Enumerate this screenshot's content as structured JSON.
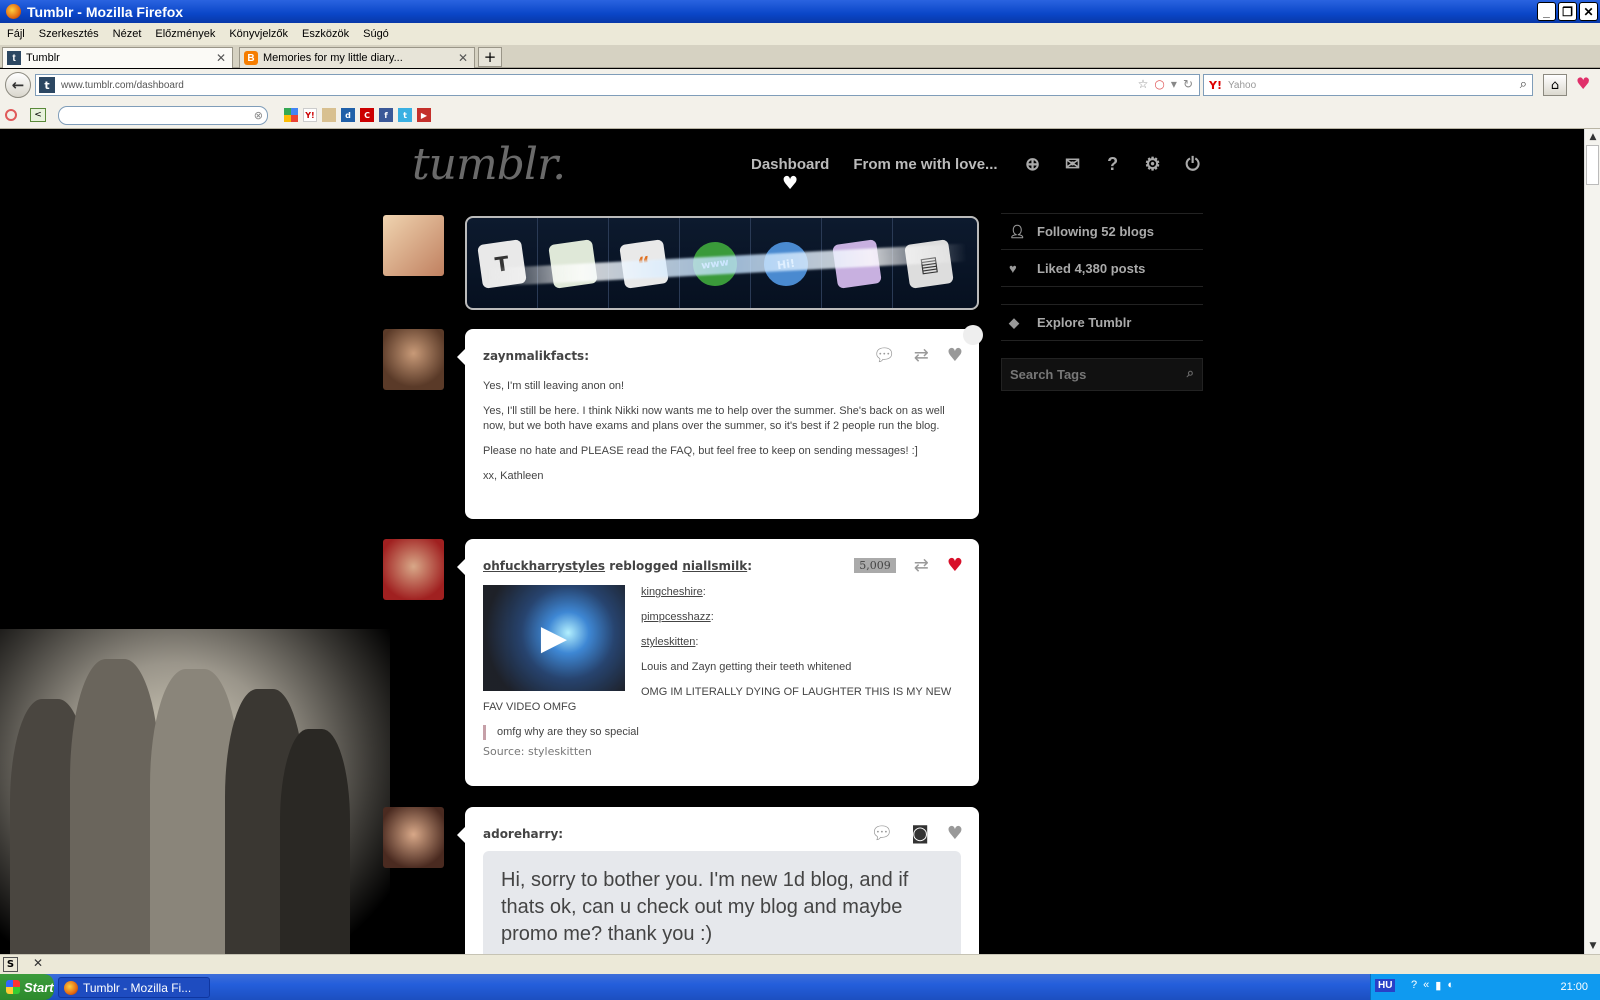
{
  "window": {
    "title": "Tumblr - Mozilla Firefox",
    "buttons": [
      "_",
      "❐",
      "✕"
    ]
  },
  "menu": [
    "Fájl",
    "Szerkesztés",
    "Nézet",
    "Előzmények",
    "Könyvjelzők",
    "Eszközök",
    "Súgó"
  ],
  "tabs": [
    {
      "label": "Tumblr",
      "favicon": "t",
      "active": true
    },
    {
      "label": "Memories for my little diary...",
      "favicon": "B",
      "active": false
    }
  ],
  "new_tab_label": "+",
  "address": {
    "url": "www.tumblr.com/dashboard",
    "favicon": "t"
  },
  "search": {
    "engine_icon": "Y!",
    "placeholder": "Yahoo"
  },
  "tumblr": {
    "logo": "tumblr.",
    "nav": {
      "dashboard": "Dashboard",
      "blog": "From me with love..."
    },
    "sidebar": {
      "following": "Following 52 blogs",
      "liked": "Liked 4,380 posts",
      "explore": "Explore Tumblr",
      "search_placeholder": "Search Tags"
    },
    "radar_icons": [
      "T",
      "",
      "",
      "www",
      "Hi!",
      "",
      ""
    ],
    "posts": [
      {
        "author": "zaynmalikfacts",
        "paragraphs": [
          "Yes, I'm still leaving anon on!",
          "Yes, I'll still be here. I think Nikki now wants me to help over the summer. She's back on as well now, but we both have exams and plans over the summer, so it's best if 2 people run the blog.",
          "Please no hate and PLEASE read the FAQ, but feel free to keep on sending messages! :]",
          "xx, Kathleen"
        ]
      },
      {
        "author": "ohfuckharrystyles",
        "reblogged_word": "reblogged",
        "source_blog": "niallsmilk",
        "notes": "5,009",
        "chain": [
          "kingcheshire",
          "pimpcesshazz",
          "styleskitten"
        ],
        "line1": "Louis and Zayn getting their teeth whitened",
        "line2": "OMG IM LITERALLY DYING OF LAUGHTER THIS IS MY NEW FAV VIDEO OMFG",
        "quote": "omfg why are they so special",
        "source": "Source: styleskitten"
      },
      {
        "author": "adoreharry",
        "ask": "Hi, sorry to bother you. I'm new 1d blog, and if thats ok, can u check out my blog and maybe promo me? thank you :)"
      }
    ]
  },
  "taskbar": {
    "start": "Start",
    "item": "Tumblr - Mozilla Fi...",
    "lang": "HU",
    "clock": "21:00"
  },
  "colors": {
    "titlebar": "#0a46c8",
    "like": "#d8102a",
    "page_bg": "#000000",
    "post_bg": "#ffffff"
  }
}
